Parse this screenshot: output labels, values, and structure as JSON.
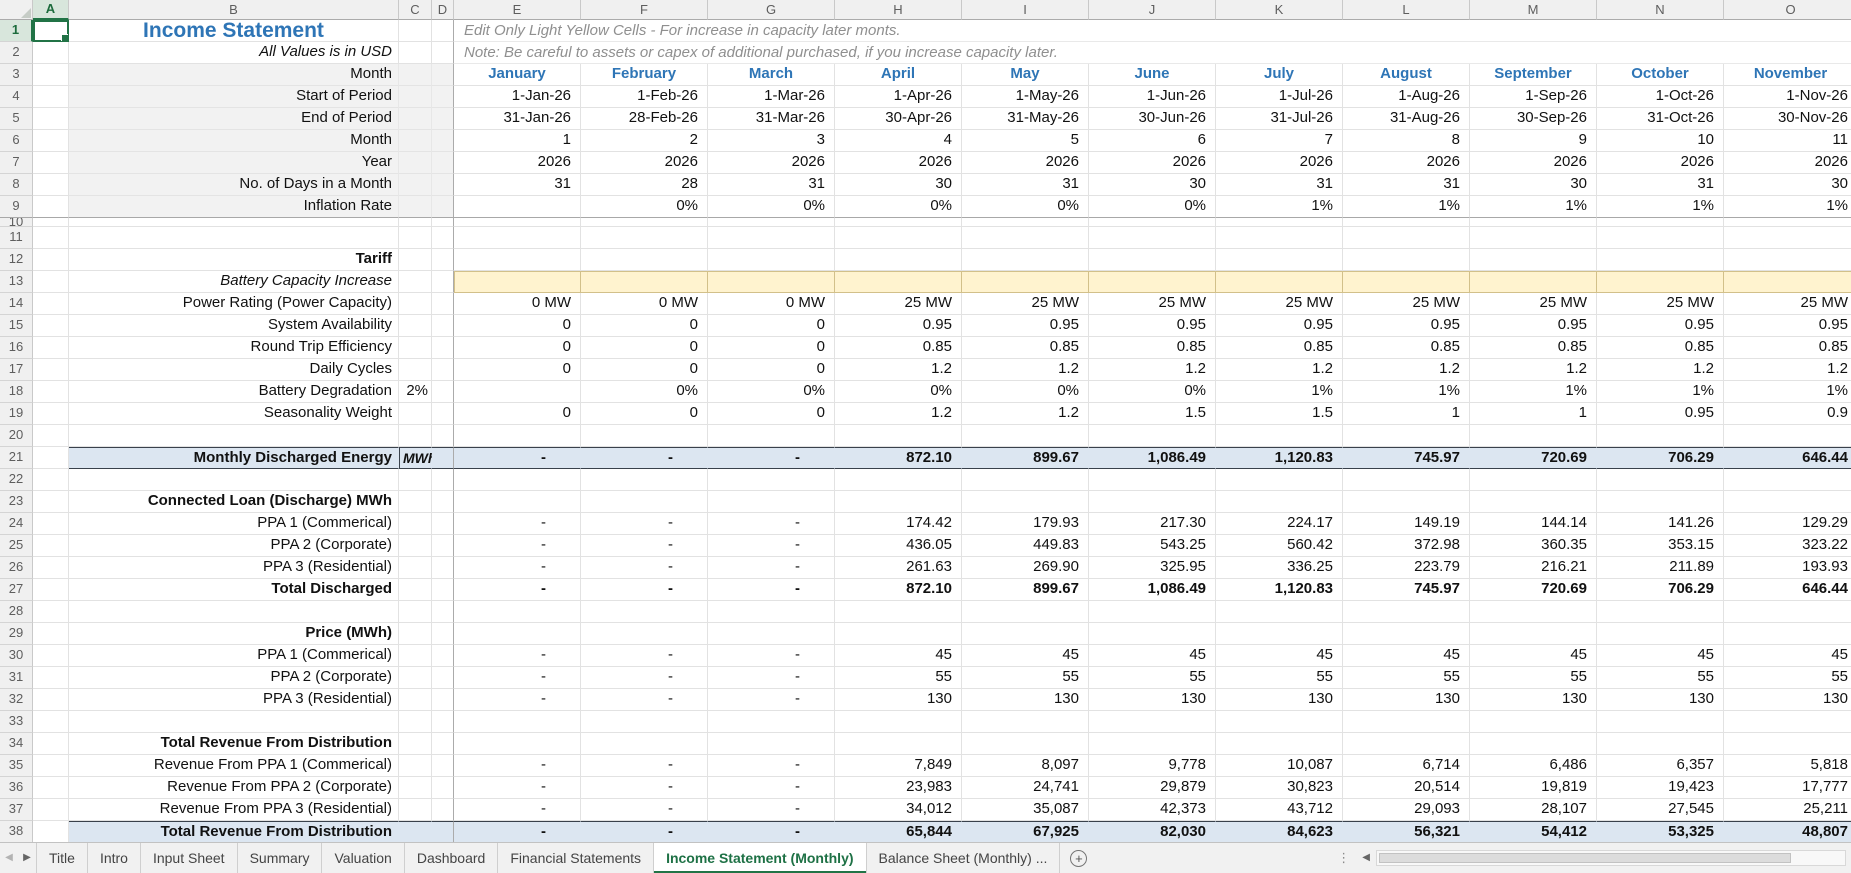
{
  "selection": {
    "cell": "A1",
    "column": "A",
    "row": 1
  },
  "icons": {
    "tabs_nav_left": "◀",
    "tabs_nav_right": "▶",
    "add_sheet": "+",
    "tab_splitter": "⋮",
    "hscroll_left": "◀"
  },
  "colors": {
    "accent_blue": "#2E75B6",
    "band_fill": "#DCE6F1",
    "input_fill": "#FFF3CF",
    "tab_green": "#217346"
  },
  "sheet": {
    "column_letters": [
      "A",
      "B",
      "C",
      "D",
      "E",
      "F",
      "G",
      "H",
      "I",
      "J",
      "K",
      "L",
      "M",
      "N",
      "O"
    ],
    "rows": [
      {
        "n": 1,
        "label": "Income Statement",
        "lcls": "title",
        "note": "Edit Only Light Yellow Cells - For increase in capacity later monts."
      },
      {
        "n": 2,
        "label": "All Values is in USD",
        "lcls": "italic",
        "note": "Note: Be careful to assets or capex of additional purchased,  if you increase capacity later."
      },
      {
        "n": 3,
        "gray": true,
        "label": "Month",
        "vcls": "month",
        "vals": [
          "January",
          "February",
          "March",
          "April",
          "May",
          "June",
          "July",
          "August",
          "September",
          "October",
          "November"
        ]
      },
      {
        "n": 4,
        "gray": true,
        "label": "Start of Period",
        "vals": [
          "1-Jan-26",
          "1-Feb-26",
          "1-Mar-26",
          "1-Apr-26",
          "1-May-26",
          "1-Jun-26",
          "1-Jul-26",
          "1-Aug-26",
          "1-Sep-26",
          "1-Oct-26",
          "1-Nov-26"
        ]
      },
      {
        "n": 5,
        "gray": true,
        "label": "End of Period",
        "vals": [
          "31-Jan-26",
          "28-Feb-26",
          "31-Mar-26",
          "30-Apr-26",
          "31-May-26",
          "30-Jun-26",
          "31-Jul-26",
          "31-Aug-26",
          "30-Sep-26",
          "31-Oct-26",
          "30-Nov-26"
        ]
      },
      {
        "n": 6,
        "gray": true,
        "label": "Month",
        "vals": [
          "1",
          "2",
          "3",
          "4",
          "5",
          "6",
          "7",
          "8",
          "9",
          "10",
          "11"
        ]
      },
      {
        "n": 7,
        "gray": true,
        "label": "Year",
        "vals": [
          "2026",
          "2026",
          "2026",
          "2026",
          "2026",
          "2026",
          "2026",
          "2026",
          "2026",
          "2026",
          "2026"
        ]
      },
      {
        "n": 8,
        "gray": true,
        "label": "No. of Days in a Month",
        "vals": [
          "31",
          "28",
          "31",
          "30",
          "31",
          "30",
          "31",
          "31",
          "30",
          "31",
          "30"
        ]
      },
      {
        "n": 9,
        "gray": true,
        "freeze": true,
        "label": "Inflation Rate",
        "vals": [
          "",
          "0%",
          "0%",
          "0%",
          "0%",
          "0%",
          "1%",
          "1%",
          "1%",
          "1%",
          "1%"
        ]
      },
      {
        "n": 10,
        "collapsed": true
      },
      {
        "n": 11
      },
      {
        "n": 12,
        "label": "Tariff",
        "lcls": "bold"
      },
      {
        "n": 13,
        "label": "Battery Capacity Increase",
        "lcls": "italic",
        "yellow": true,
        "vals": [
          "",
          "",
          "",
          "",
          "",
          "",
          "",
          "",
          "",
          "",
          ""
        ]
      },
      {
        "n": 14,
        "label": "Power Rating (Power Capacity)",
        "vals": [
          "0 MW",
          "0 MW",
          "0 MW",
          "25 MW",
          "25 MW",
          "25 MW",
          "25 MW",
          "25 MW",
          "25 MW",
          "25 MW",
          "25 MW"
        ]
      },
      {
        "n": 15,
        "label": "System Availability",
        "vals": [
          "0",
          "0",
          "0",
          "0.95",
          "0.95",
          "0.95",
          "0.95",
          "0.95",
          "0.95",
          "0.95",
          "0.95"
        ]
      },
      {
        "n": 16,
        "label": "Round Trip Efficiency",
        "vals": [
          "0",
          "0",
          "0",
          "0.85",
          "0.85",
          "0.85",
          "0.85",
          "0.85",
          "0.85",
          "0.85",
          "0.85"
        ]
      },
      {
        "n": 17,
        "label": "Daily Cycles",
        "vals": [
          "0",
          "0",
          "0",
          "1.2",
          "1.2",
          "1.2",
          "1.2",
          "1.2",
          "1.2",
          "1.2",
          "1.2"
        ]
      },
      {
        "n": 18,
        "label": "Battery Degradation",
        "c": "2%",
        "ccls": "cnum",
        "vals": [
          "",
          "0%",
          "0%",
          "0%",
          "0%",
          "0%",
          "1%",
          "1%",
          "1%",
          "1%",
          "1%"
        ]
      },
      {
        "n": 19,
        "label": "Seasonality Weight",
        "vals": [
          "0",
          "0",
          "0",
          "1.2",
          "1.2",
          "1.5",
          "1.5",
          "1",
          "1",
          "0.95",
          "0.9"
        ]
      },
      {
        "n": 20
      },
      {
        "n": 21,
        "band": true,
        "cline": true,
        "label": "Monthly Discharged Energy",
        "c": "MWh",
        "ccls": "unit",
        "vals": [
          "-",
          "-",
          "-",
          "872.10",
          "899.67",
          "1,086.49",
          "1,120.83",
          "745.97",
          "720.69",
          "706.29",
          "646.44"
        ]
      },
      {
        "n": 22
      },
      {
        "n": 23,
        "label": "Connected Loan (Discharge) MWh",
        "lcls": "bold"
      },
      {
        "n": 24,
        "label": "PPA 1 (Commerical)",
        "vals": [
          "-",
          "-",
          "-",
          "174.42",
          "179.93",
          "217.30",
          "224.17",
          "149.19",
          "144.14",
          "141.26",
          "129.29"
        ]
      },
      {
        "n": 25,
        "label": "PPA 2 (Corporate)",
        "vals": [
          "-",
          "-",
          "-",
          "436.05",
          "449.83",
          "543.25",
          "560.42",
          "372.98",
          "360.35",
          "353.15",
          "323.22"
        ]
      },
      {
        "n": 26,
        "label": "PPA 3 (Residential)",
        "vals": [
          "-",
          "-",
          "-",
          "261.63",
          "269.90",
          "325.95",
          "336.25",
          "223.79",
          "216.21",
          "211.89",
          "193.93"
        ]
      },
      {
        "n": 27,
        "label": "Total Discharged",
        "lcls": "bold",
        "vcls": "num bold",
        "vals": [
          "-",
          "-",
          "-",
          "872.10",
          "899.67",
          "1,086.49",
          "1,120.83",
          "745.97",
          "720.69",
          "706.29",
          "646.44"
        ]
      },
      {
        "n": 28
      },
      {
        "n": 29,
        "label": "Price (MWh)",
        "lcls": "bold"
      },
      {
        "n": 30,
        "label": "PPA 1 (Commerical)",
        "vals": [
          "-",
          "-",
          "-",
          "45",
          "45",
          "45",
          "45",
          "45",
          "45",
          "45",
          "45"
        ]
      },
      {
        "n": 31,
        "label": "PPA 2 (Corporate)",
        "vals": [
          "-",
          "-",
          "-",
          "55",
          "55",
          "55",
          "55",
          "55",
          "55",
          "55",
          "55"
        ]
      },
      {
        "n": 32,
        "label": "PPA 3 (Residential)",
        "vals": [
          "-",
          "-",
          "-",
          "130",
          "130",
          "130",
          "130",
          "130",
          "130",
          "130",
          "130"
        ]
      },
      {
        "n": 33
      },
      {
        "n": 34,
        "label": "Total Revenue From Distribution",
        "lcls": "bold"
      },
      {
        "n": 35,
        "label": "Revenue From PPA 1 (Commerical)",
        "vals": [
          "-",
          "-",
          "-",
          "7,849",
          "8,097",
          "9,778",
          "10,087",
          "6,714",
          "6,486",
          "6,357",
          "5,818"
        ]
      },
      {
        "n": 36,
        "label": "Revenue From PPA 2 (Corporate)",
        "vals": [
          "-",
          "-",
          "-",
          "23,983",
          "24,741",
          "29,879",
          "30,823",
          "20,514",
          "19,819",
          "19,423",
          "17,777"
        ]
      },
      {
        "n": 37,
        "label": "Revenue From PPA 3 (Residential)",
        "vals": [
          "-",
          "-",
          "-",
          "34,012",
          "35,087",
          "42,373",
          "43,712",
          "29,093",
          "28,107",
          "27,545",
          "25,211"
        ]
      },
      {
        "n": 38,
        "band": true,
        "label": "Total Revenue From Distribution",
        "vals": [
          "-",
          "-",
          "-",
          "65,844",
          "67,925",
          "82,030",
          "84,623",
          "56,321",
          "54,412",
          "53,325",
          "48,807"
        ]
      }
    ]
  },
  "tab_bar": {
    "tabs": [
      {
        "label": "Title"
      },
      {
        "label": "Intro"
      },
      {
        "label": "Input Sheet"
      },
      {
        "label": "Summary"
      },
      {
        "label": "Valuation"
      },
      {
        "label": "Dashboard"
      },
      {
        "label": "Financial Statements"
      },
      {
        "label": "Income Statement (Monthly)",
        "active": true
      },
      {
        "label": "Balance Sheet (Monthly) ..."
      }
    ]
  }
}
